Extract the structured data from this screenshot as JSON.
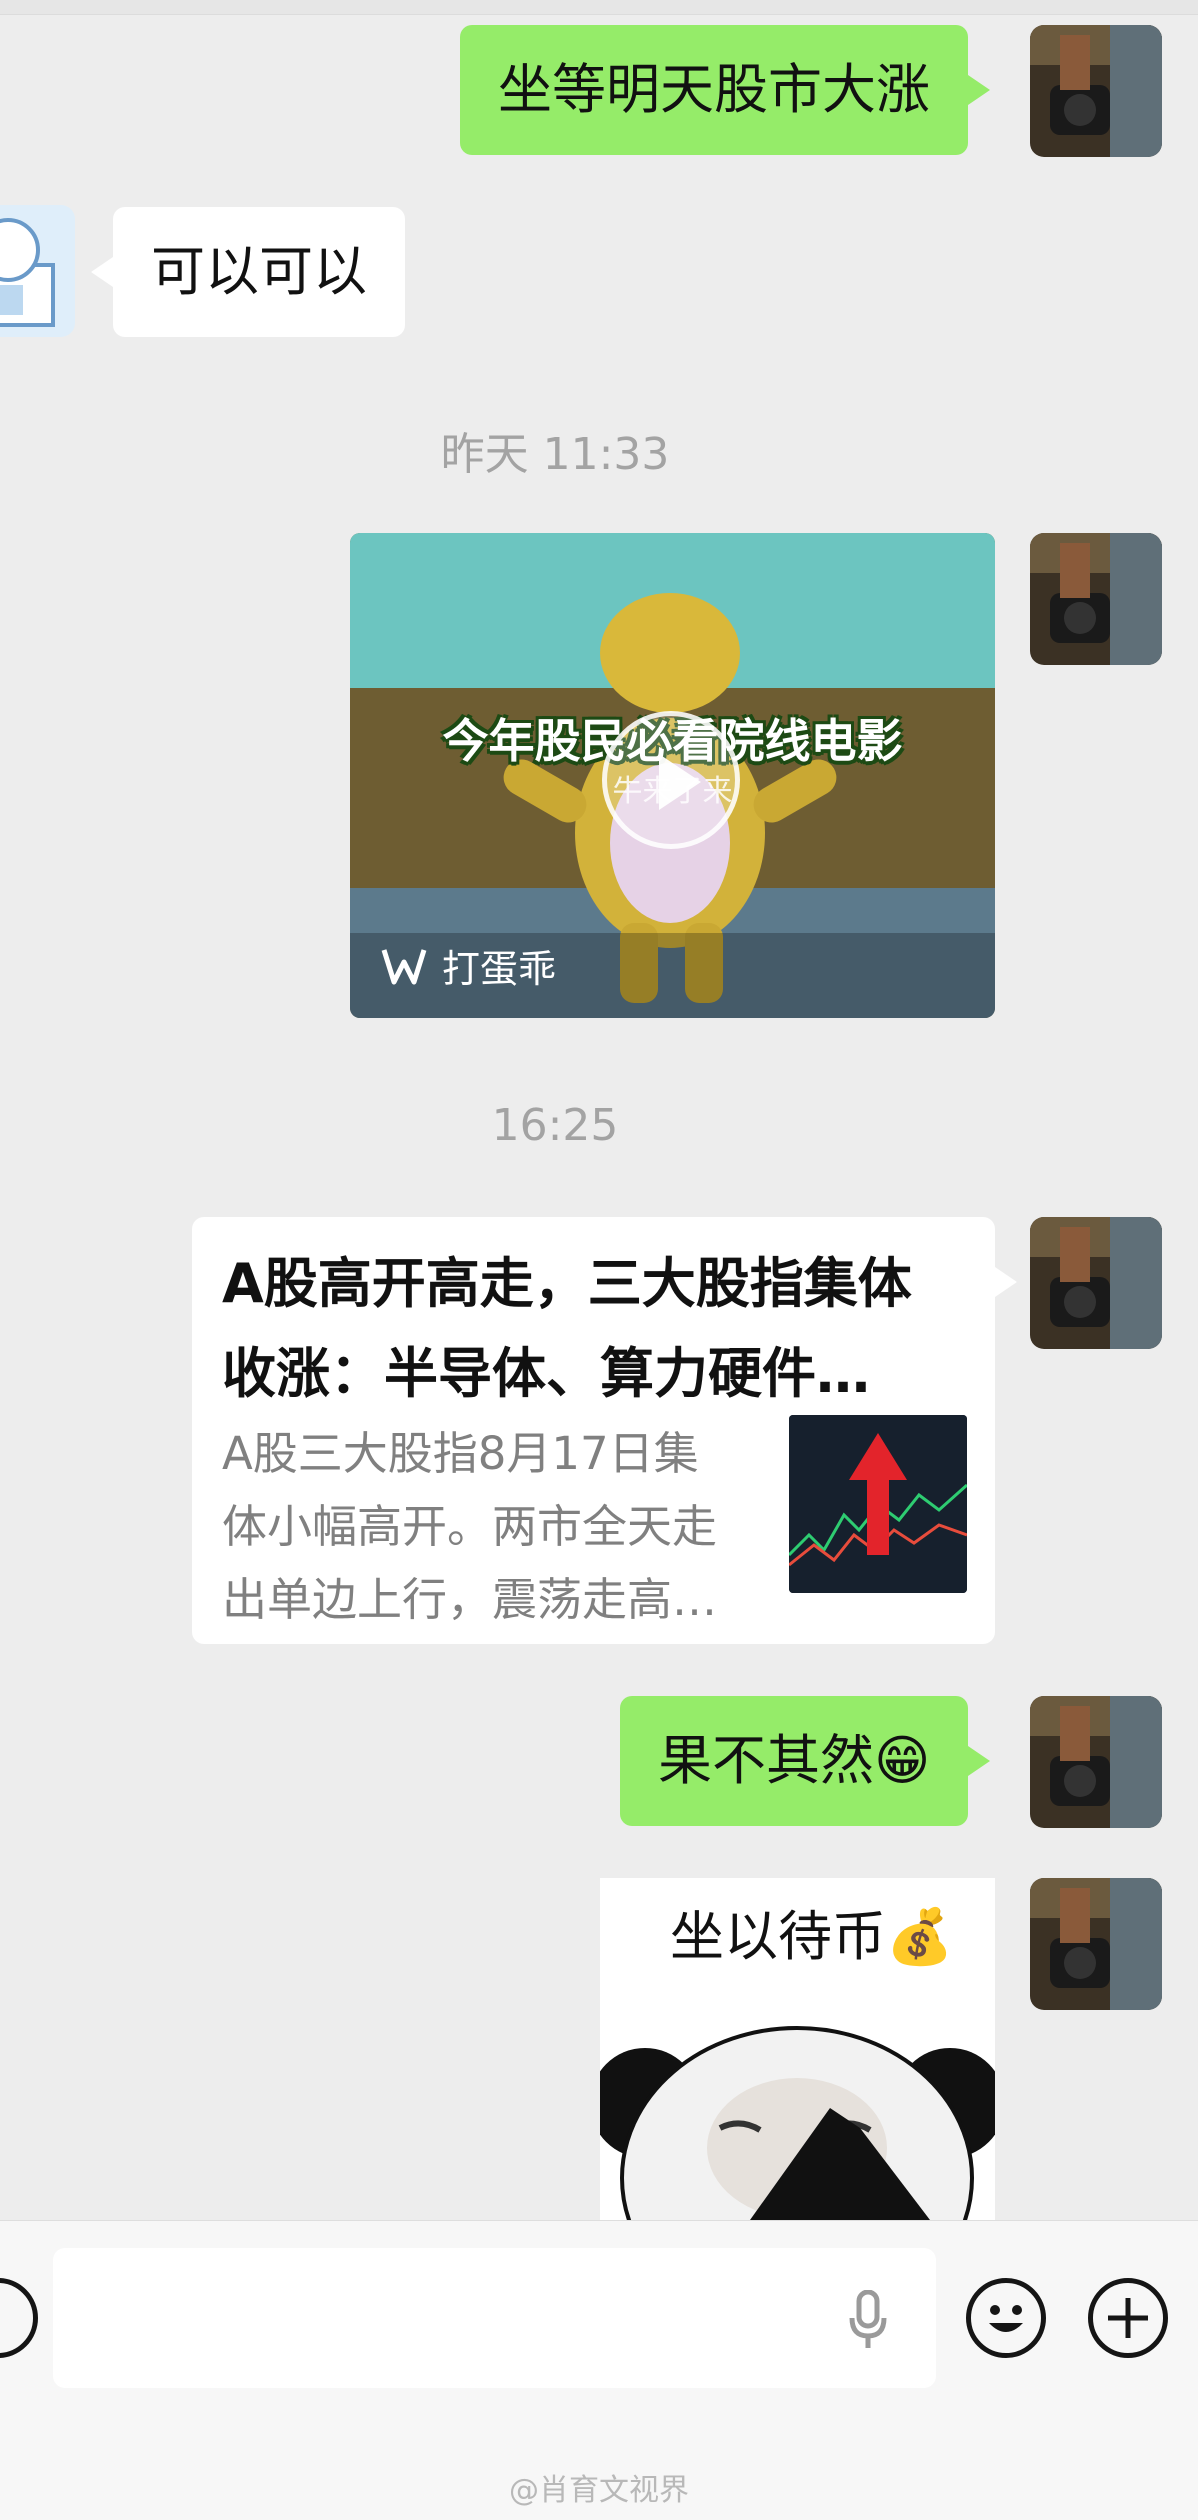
{
  "messages": {
    "msg1_text": "坐等明天股市大涨",
    "msg2_text": "可以可以",
    "time1": "昨天 11:33",
    "video": {
      "overlay_text": "今年股民必看院线电影",
      "sub_text": "牛来了来",
      "brand_label": "打蛋乖"
    },
    "time2": "16:25",
    "link": {
      "title_line1": "A股高开高走，三大股指集体",
      "title_line2": "收涨：半导体、算力硬件…",
      "desc_line1": "A股三大股指8月17日集",
      "desc_line2": "体小幅高开。两市全天走",
      "desc_line3": "出单边上行，震荡走高…"
    },
    "msg5_text": "果不其然",
    "msg5_emoji": "😁",
    "sticker_text": "坐以待币",
    "sticker_emoji": "💰"
  },
  "input_bar": {
    "voice_icon": "voice-icon",
    "mic_icon": "microphone-icon",
    "emoji_icon": "smiley-icon",
    "add_icon": "plus-icon"
  },
  "watermark": "@肖育文视界",
  "colors": {
    "background": "#ededed",
    "sent_bubble": "#95ec69",
    "received_bubble": "#ffffff",
    "timestamp": "#a3a3a3",
    "link_desc": "#808080"
  }
}
